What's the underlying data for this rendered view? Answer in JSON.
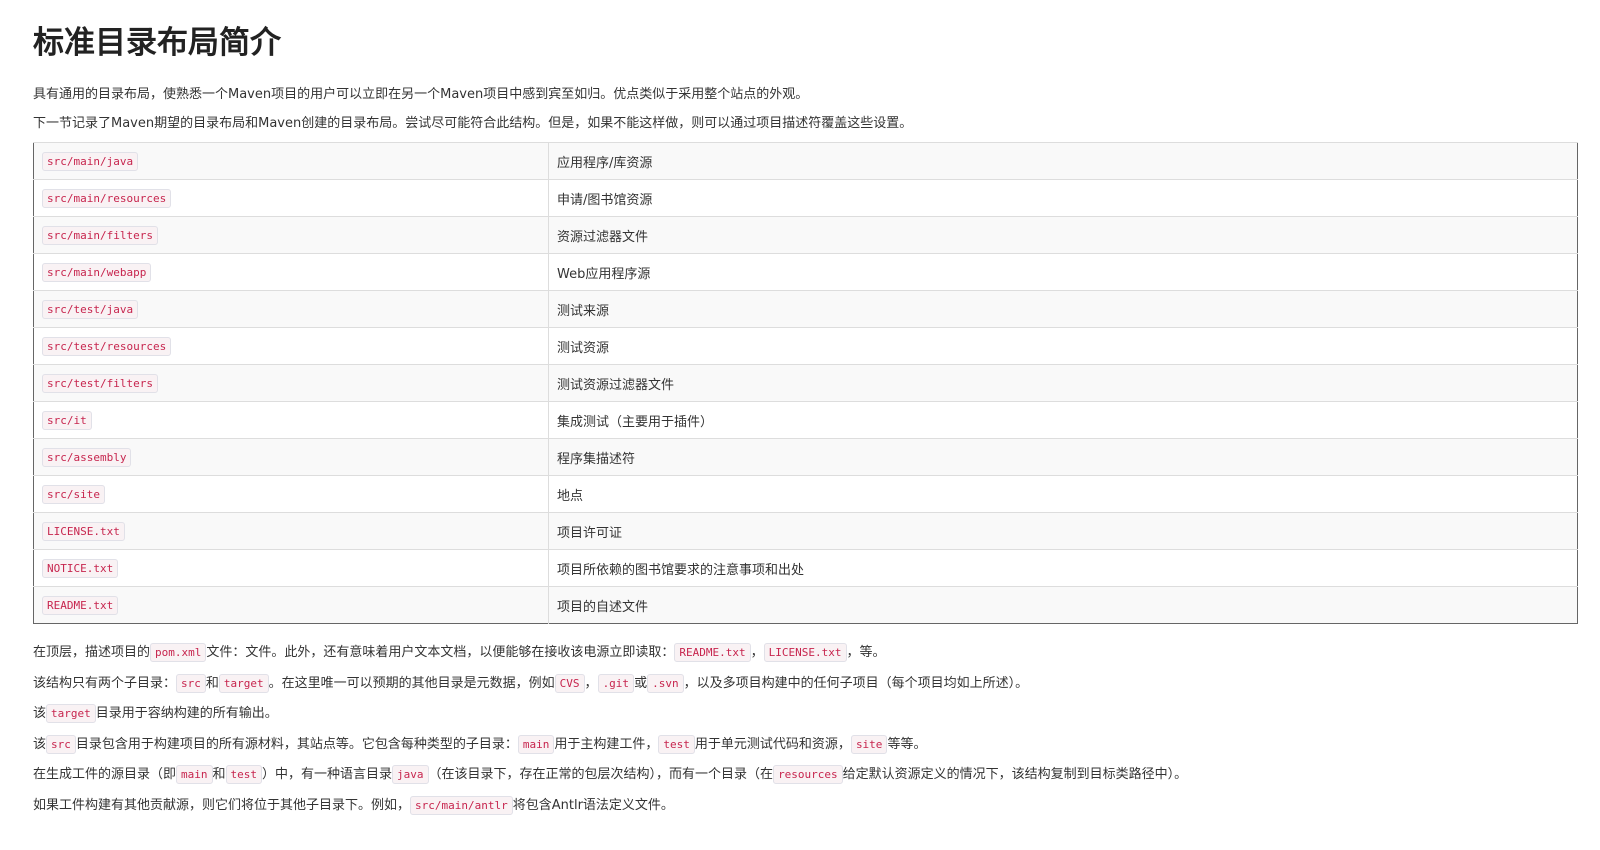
{
  "title": "标准目录布局简介",
  "intro": [
    "具有通用的目录布局，使熟悉一个Maven项目的用户可以立即在另一个Maven项目中感到宾至如归。优点类似于采用整个站点的外观。",
    "下一节记录了Maven期望的目录布局和Maven创建的目录布局。尝试尽可能符合此结构。但是，如果不能这样做，则可以通过项目描述符覆盖这些设置。"
  ],
  "table": [
    {
      "path": "src/main/java",
      "desc": "应用程序/库资源"
    },
    {
      "path": "src/main/resources",
      "desc": "申请/图书馆资源"
    },
    {
      "path": "src/main/filters",
      "desc": "资源过滤器文件"
    },
    {
      "path": "src/main/webapp",
      "desc": "Web应用程序源"
    },
    {
      "path": "src/test/java",
      "desc": "测试来源"
    },
    {
      "path": "src/test/resources",
      "desc": "测试资源"
    },
    {
      "path": "src/test/filters",
      "desc": "测试资源过滤器文件"
    },
    {
      "path": "src/it",
      "desc": "集成测试（主要用于插件）"
    },
    {
      "path": "src/assembly",
      "desc": "程序集描述符"
    },
    {
      "path": "src/site",
      "desc": "地点"
    },
    {
      "path": "LICENSE.txt",
      "desc": "项目许可证"
    },
    {
      "path": "NOTICE.txt",
      "desc": "项目所依赖的图书馆要求的注意事项和出处"
    },
    {
      "path": "README.txt",
      "desc": "项目的自述文件"
    }
  ],
  "paragraphs": [
    {
      "t1": "在顶层，描述项目的",
      "c1": "pom.xml",
      "t2": "文件：文件。此外，还有意味着用户文本文档，以便能够在接收该电源立即读取：",
      "c2": "README.txt",
      "t3": "，",
      "c3": "LICENSE.txt",
      "t4": "，等。"
    },
    {
      "t1": "该结构只有两个子目录：",
      "c1": "src",
      "t2": "和",
      "c2": "target",
      "t3": "。在这里唯一可以预期的其他目录是元数据，例如",
      "c3": "CVS",
      "t4": "，",
      "c4": ".git",
      "t5": "或",
      "c5": ".svn",
      "t6": "，以及多项目构建中的任何子项目（每个项目均如上所述）。"
    },
    {
      "t1": "该",
      "c1": "target",
      "t2": "目录用于容纳构建的所有输出。"
    },
    {
      "t1": "该",
      "c1": "src",
      "t2": "目录包含用于构建项目的所有源材料，其站点等。它包含每种类型的子目录：",
      "c2": "main",
      "t3": "用于主构建工件，",
      "c3": "test",
      "t4": "用于单元测试代码和资源，",
      "c4": "site",
      "t5": "等等。"
    },
    {
      "t1": "在生成工件的源目录（即",
      "c1": "main",
      "t2": "和",
      "c2": "test",
      "t3": "）中，有一种语言目录",
      "c3": "java",
      "t4": "（在该目录下，存在正常的包层次结构），而有一个目录（在",
      "c4": "resources",
      "t5": "给定默认资源定义的情况下，该结构复制到目标类路径中）。"
    },
    {
      "t1": "如果工件构建有其他贡献源，则它们将位于其他子目录下。例如，",
      "c1": "src/main/antlr",
      "t2": "将包含Antlr语法定义文件。"
    }
  ]
}
